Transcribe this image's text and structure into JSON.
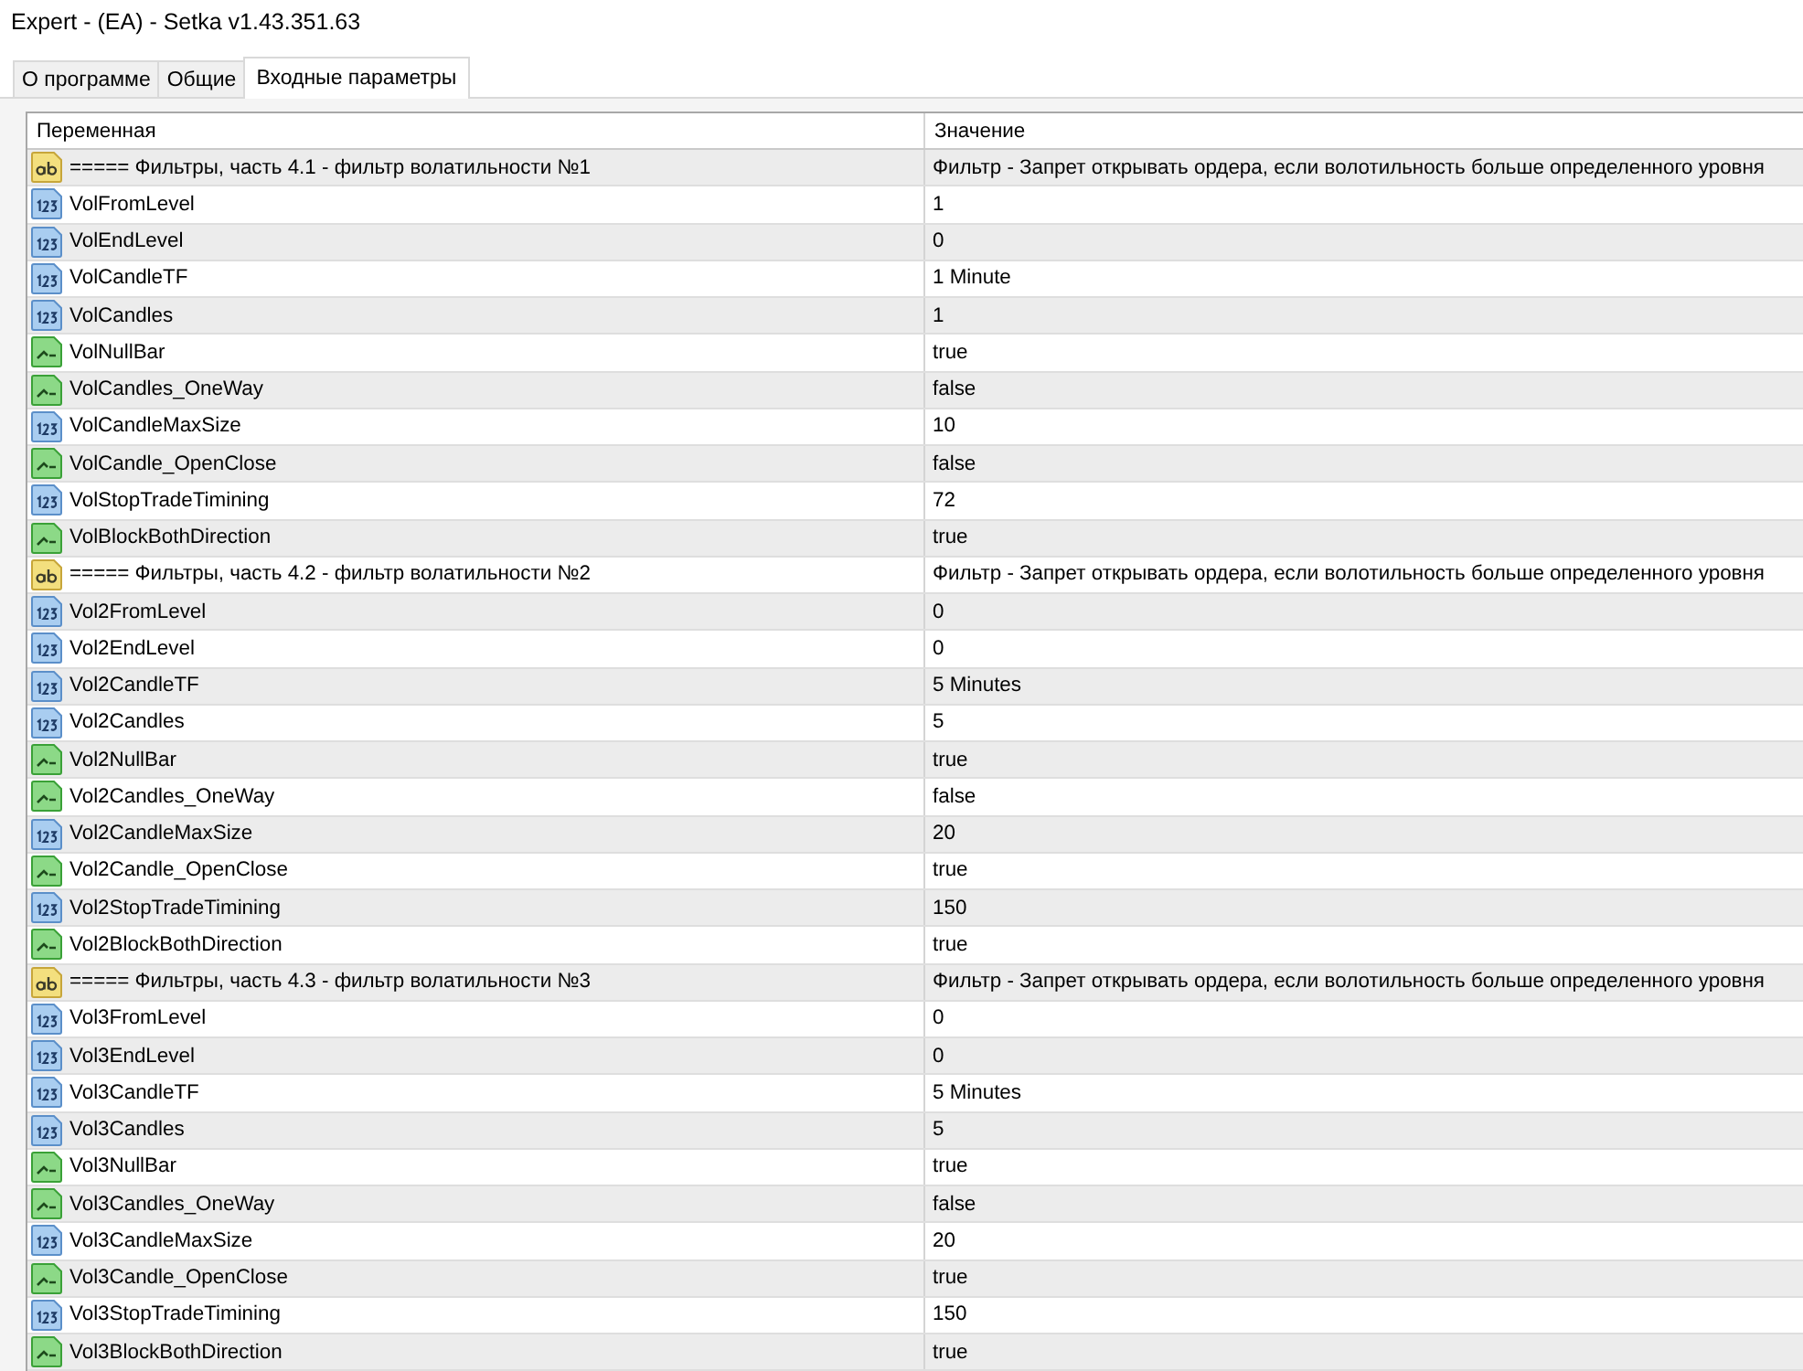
{
  "window": {
    "title": "Expert - (EA) - Setka v1.43.351.63"
  },
  "tabs": [
    {
      "label": "О программе",
      "selected": false
    },
    {
      "label": "Общие",
      "selected": false
    },
    {
      "label": "Входные параметры",
      "selected": true
    }
  ],
  "table": {
    "columns": [
      "Переменная",
      "Значение"
    ],
    "rows": [
      {
        "kind": "string",
        "name": "===== Фильтры, часть 4.1 - фильтр волатильности №1",
        "value": "Фильтр - Запрет открывать ордера, если волотильность больше определенного уровня"
      },
      {
        "kind": "int",
        "name": "VolFromLevel",
        "value": "1"
      },
      {
        "kind": "int",
        "name": "VolEndLevel",
        "value": "0"
      },
      {
        "kind": "int",
        "name": "VolCandleTF",
        "value": "1 Minute"
      },
      {
        "kind": "int",
        "name": "VolCandles",
        "value": "1"
      },
      {
        "kind": "bool",
        "name": "VolNullBar",
        "value": "true"
      },
      {
        "kind": "bool",
        "name": "VolCandles_OneWay",
        "value": "false"
      },
      {
        "kind": "int",
        "name": "VolCandleMaxSize",
        "value": "10"
      },
      {
        "kind": "bool",
        "name": "VolCandle_OpenClose",
        "value": "false"
      },
      {
        "kind": "int",
        "name": "VolStopTradeTimining",
        "value": "72"
      },
      {
        "kind": "bool",
        "name": "VolBlockBothDirection",
        "value": "true"
      },
      {
        "kind": "string",
        "name": "===== Фильтры, часть 4.2 - фильтр волатильности №2",
        "value": "Фильтр - Запрет открывать ордера, если волотильность больше определенного уровня"
      },
      {
        "kind": "int",
        "name": "Vol2FromLevel",
        "value": "0"
      },
      {
        "kind": "int",
        "name": "Vol2EndLevel",
        "value": "0"
      },
      {
        "kind": "int",
        "name": "Vol2CandleTF",
        "value": "5 Minutes"
      },
      {
        "kind": "int",
        "name": "Vol2Candles",
        "value": "5"
      },
      {
        "kind": "bool",
        "name": "Vol2NullBar",
        "value": "true"
      },
      {
        "kind": "bool",
        "name": "Vol2Candles_OneWay",
        "value": "false"
      },
      {
        "kind": "int",
        "name": "Vol2CandleMaxSize",
        "value": "20"
      },
      {
        "kind": "bool",
        "name": "Vol2Candle_OpenClose",
        "value": "true"
      },
      {
        "kind": "int",
        "name": "Vol2StopTradeTimining",
        "value": "150"
      },
      {
        "kind": "bool",
        "name": "Vol2BlockBothDirection",
        "value": "true"
      },
      {
        "kind": "string",
        "name": "===== Фильтры, часть 4.3 - фильтр волатильности №3",
        "value": "Фильтр - Запрет открывать ордера, если волотильность больше определенного уровня"
      },
      {
        "kind": "int",
        "name": "Vol3FromLevel",
        "value": "0"
      },
      {
        "kind": "int",
        "name": "Vol3EndLevel",
        "value": "0"
      },
      {
        "kind": "int",
        "name": "Vol3CandleTF",
        "value": "5 Minutes"
      },
      {
        "kind": "int",
        "name": "Vol3Candles",
        "value": "5"
      },
      {
        "kind": "bool",
        "name": "Vol3NullBar",
        "value": "true"
      },
      {
        "kind": "bool",
        "name": "Vol3Candles_OneWay",
        "value": "false"
      },
      {
        "kind": "int",
        "name": "Vol3CandleMaxSize",
        "value": "20"
      },
      {
        "kind": "bool",
        "name": "Vol3Candle_OpenClose",
        "value": "true"
      },
      {
        "kind": "int",
        "name": "Vol3StopTradeTimining",
        "value": "150"
      },
      {
        "kind": "bool",
        "name": "Vol3BlockBothDirection",
        "value": "true"
      }
    ]
  }
}
